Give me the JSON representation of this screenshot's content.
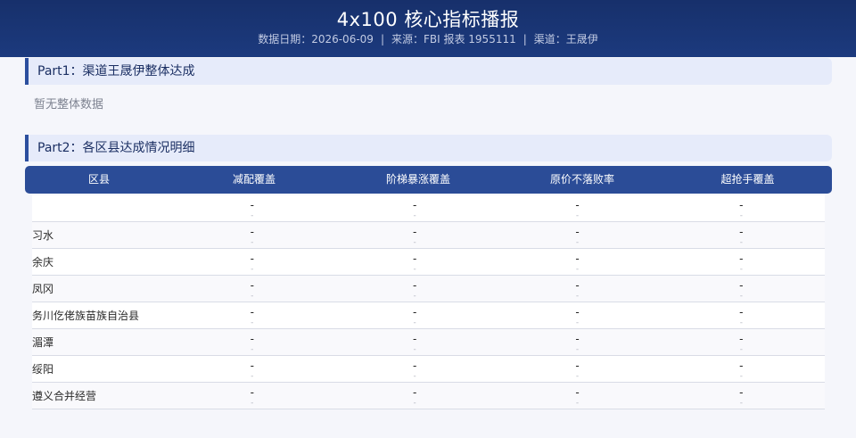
{
  "header": {
    "title": "4x100 核心指标播报",
    "date_text": "数据日期：2026-06-09",
    "source_text": "来源：FBI 报表 1955111",
    "channel_text": "渠道：王晟伊",
    "separator": "|"
  },
  "part1": {
    "title": "Part1：渠道王晟伊整体达成",
    "empty_note": "暂无整体数据"
  },
  "part2": {
    "title": "Part2：各区县达成情况明细",
    "columns": [
      "区县",
      "减配覆盖",
      "阶梯暴涨覆盖",
      "原价不落败率",
      "超抢手覆盖"
    ],
    "rows": [
      {
        "name": "",
        "cells": [
          {
            "v": "-",
            "s": "-"
          },
          {
            "v": "-",
            "s": "-"
          },
          {
            "v": "-",
            "s": "-"
          },
          {
            "v": "-",
            "s": "-"
          }
        ]
      },
      {
        "name": "习水",
        "cells": [
          {
            "v": "-",
            "s": "-"
          },
          {
            "v": "-",
            "s": "-"
          },
          {
            "v": "-",
            "s": "-"
          },
          {
            "v": "-",
            "s": "-"
          }
        ]
      },
      {
        "name": "余庆",
        "cells": [
          {
            "v": "-",
            "s": "-"
          },
          {
            "v": "-",
            "s": "-"
          },
          {
            "v": "-",
            "s": "-"
          },
          {
            "v": "-",
            "s": "-"
          }
        ]
      },
      {
        "name": "凤冈",
        "cells": [
          {
            "v": "-",
            "s": "-"
          },
          {
            "v": "-",
            "s": "-"
          },
          {
            "v": "-",
            "s": "-"
          },
          {
            "v": "-",
            "s": "-"
          }
        ]
      },
      {
        "name": "务川仡佬族苗族自治县",
        "cells": [
          {
            "v": "-",
            "s": "-"
          },
          {
            "v": "-",
            "s": "-"
          },
          {
            "v": "-",
            "s": "-"
          },
          {
            "v": "-",
            "s": "-"
          }
        ]
      },
      {
        "name": "湄潭",
        "cells": [
          {
            "v": "-",
            "s": "-"
          },
          {
            "v": "-",
            "s": "-"
          },
          {
            "v": "-",
            "s": "-"
          },
          {
            "v": "-",
            "s": "-"
          }
        ]
      },
      {
        "name": "绥阳",
        "cells": [
          {
            "v": "-",
            "s": "-"
          },
          {
            "v": "-",
            "s": "-"
          },
          {
            "v": "-",
            "s": "-"
          },
          {
            "v": "-",
            "s": "-"
          }
        ]
      },
      {
        "name": "遵义合并经营",
        "cells": [
          {
            "v": "-",
            "s": "-"
          },
          {
            "v": "-",
            "s": "-"
          },
          {
            "v": "-",
            "s": "-"
          },
          {
            "v": "-",
            "s": "-"
          }
        ]
      }
    ]
  },
  "colors": {
    "header_bg": "#1c3a7e",
    "table_header_bg": "#2b4c97",
    "section_bg": "#e6ebfa",
    "section_accent": "#2c4f9e"
  }
}
